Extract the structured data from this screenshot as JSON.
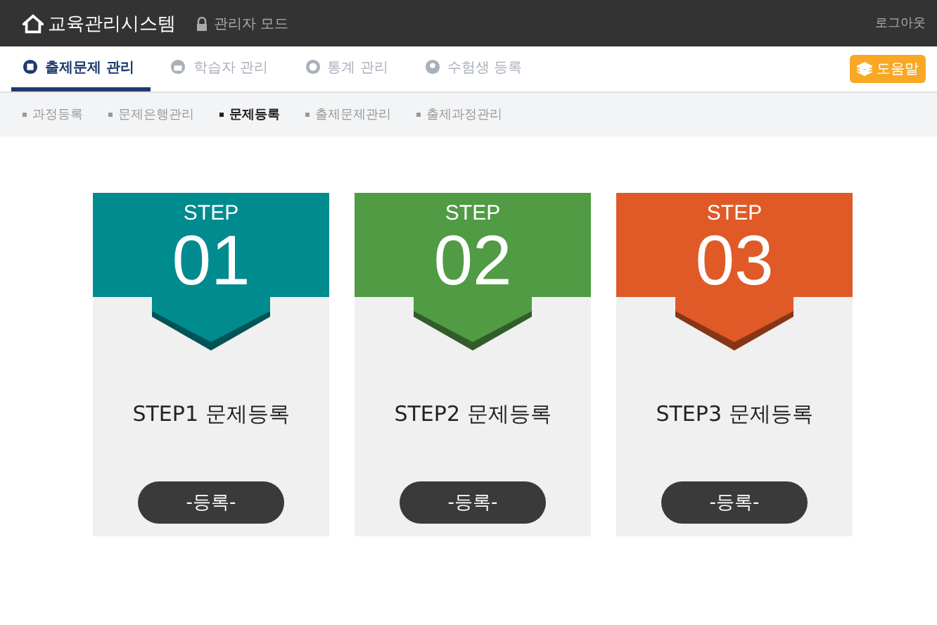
{
  "header": {
    "title": "교육관리시스템",
    "mode": "관리자 모드",
    "logout": "로그아웃"
  },
  "tabs": [
    {
      "label": "출제문제 관리",
      "selected": true
    },
    {
      "label": "학습자 관리",
      "selected": false
    },
    {
      "label": "통계 관리",
      "selected": false
    },
    {
      "label": "수험생 등록",
      "selected": false
    }
  ],
  "help_button": "도움말",
  "sub_menu": [
    {
      "label": "과정등록",
      "selected": false
    },
    {
      "label": "문제은행관리",
      "selected": false
    },
    {
      "label": "문제등록",
      "selected": true
    },
    {
      "label": "출제문제관리",
      "selected": false
    },
    {
      "label": "출제과정관리",
      "selected": false
    }
  ],
  "steps": [
    {
      "step_label": "STEP",
      "number": "01",
      "title": "STEP1 문제등록",
      "button": "-등록-",
      "color": "#008b8f"
    },
    {
      "step_label": "STEP",
      "number": "02",
      "title": "STEP2 문제등록",
      "button": "-등록-",
      "color": "#509b44"
    },
    {
      "step_label": "STEP",
      "number": "03",
      "title": "STEP3 문제등록",
      "button": "-등록-",
      "color": "#e05a27"
    }
  ]
}
